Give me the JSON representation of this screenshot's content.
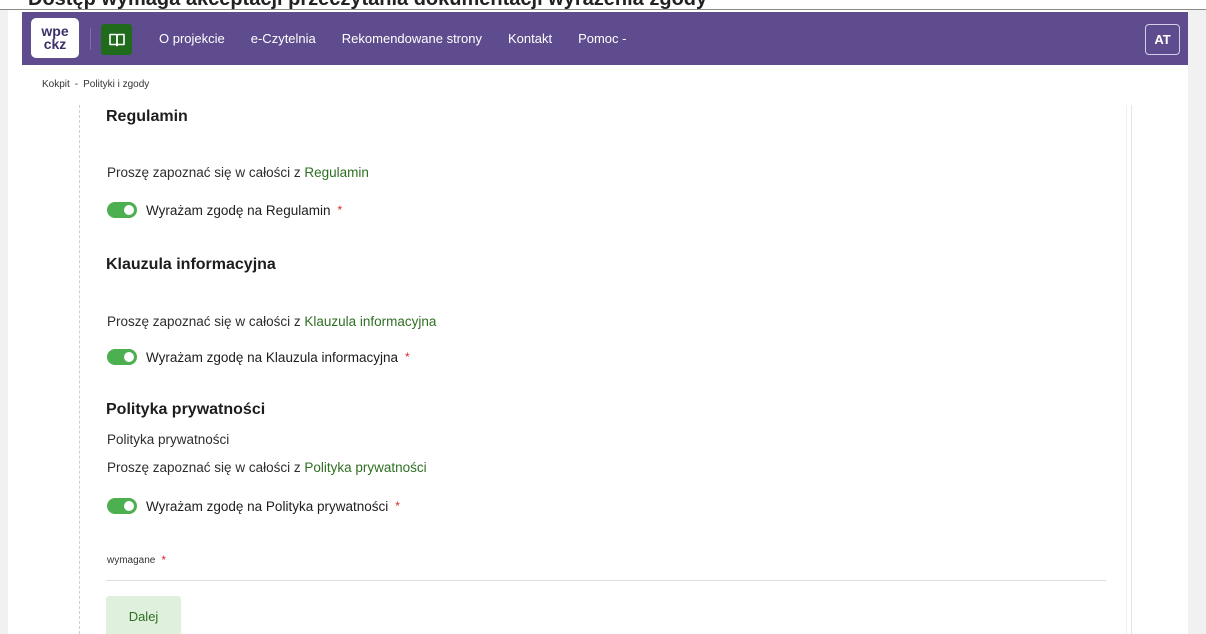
{
  "top_strip": {
    "text": "Dostęp wymaga akceptacji przeczytania dokumentacji wyrażenia zgody"
  },
  "navbar": {
    "logo_line1": "wpe",
    "logo_line2": "ckz",
    "links": [
      "O projekcie",
      "e-Czytelnia",
      "Rekomendowane strony",
      "Kontakt",
      "Pomoc -"
    ],
    "avatar": "AT",
    "colors": {
      "bar": "#5e4c8e",
      "book_button": "#1f6b1b"
    }
  },
  "breadcrumb": {
    "items": [
      "Kokpit",
      "Polityki i zgody"
    ],
    "separator": "-"
  },
  "sections": [
    {
      "title": "Regulamin",
      "description": "",
      "read_text": "Proszę zapoznać się w całości z ",
      "read_link": "Regulamin",
      "consent_label": "Wyrażam zgodę na Regulamin",
      "consent_checked": true
    },
    {
      "title": "Klauzula informacyjna",
      "description": "",
      "read_text": "Proszę zapoznać się w całości z ",
      "read_link": "Klauzula informacyjna",
      "consent_label": "Wyrażam zgodę na Klauzula informacyjna",
      "consent_checked": true
    },
    {
      "title": "Polityka prywatności",
      "description": "Polityka prywatności",
      "read_text": "Proszę zapoznać się w całości z ",
      "read_link": "Polityka prywatności",
      "consent_label": "Wyrażam zgodę na Polityka prywatności",
      "consent_checked": true
    }
  ],
  "required_marker": "*",
  "required_note": "wymagane",
  "next_button": "Dalej",
  "colors": {
    "link": "#2f6f22",
    "toggle_on": "#4caf50",
    "required": "#d62b2b",
    "button_bg": "#dff0dc"
  }
}
